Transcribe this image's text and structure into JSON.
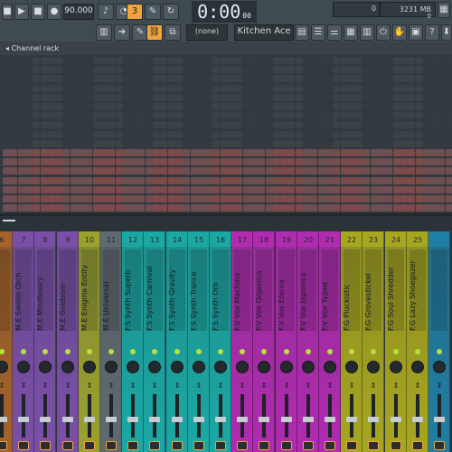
{
  "toolbar": {
    "tempo": "90.000",
    "time": "0:00",
    "time_suffix": "00",
    "meter_value": "0",
    "memory_value": "3231 MB",
    "memory_zero": "0",
    "pattern_select": "(none)",
    "preset": "Kitchen Ace"
  },
  "channel_rack": {
    "title": "Channel rack"
  },
  "mixer": {
    "strips": [
      {
        "num": "6",
        "name": "",
        "color": "#a5622b"
      },
      {
        "num": "7",
        "name": "M.E Swolln Orch",
        "color": "#7a4fa8"
      },
      {
        "num": "8",
        "name": "M.E Mindlessry",
        "color": "#7a4fa8"
      },
      {
        "num": "9",
        "name": "M.E Goldsom",
        "color": "#7a4fa8"
      },
      {
        "num": "10",
        "name": "M.E Enigma Entity",
        "color": "#9aa12f"
      },
      {
        "num": "11",
        "name": "M.E Universal",
        "color": "#5f6a70"
      },
      {
        "num": "12",
        "name": "F.S Synth Superb",
        "color": "#1aa8a5"
      },
      {
        "num": "13",
        "name": "F.S Synth Carnival",
        "color": "#1aa8a5"
      },
      {
        "num": "14",
        "name": "F.S Synth Gravity",
        "color": "#1aa8a5"
      },
      {
        "num": "15",
        "name": "F.S Synth Trance",
        "color": "#1aa8a5"
      },
      {
        "num": "16",
        "name": "F.S Synth Orb",
        "color": "#1aa8a5"
      },
      {
        "num": "17",
        "name": "F.V Vox Machina",
        "color": "#b02bb0"
      },
      {
        "num": "18",
        "name": "F.V Vox Organica",
        "color": "#b02bb0"
      },
      {
        "num": "19",
        "name": "F.V Vox Eterna",
        "color": "#b02bb0"
      },
      {
        "num": "20",
        "name": "F.V Vox Japonica",
        "color": "#b02bb0"
      },
      {
        "num": "21",
        "name": "F.V Vox Typed",
        "color": "#b02bb0"
      },
      {
        "num": "22",
        "name": "F.G Pluckistic",
        "color": "#a7a61f"
      },
      {
        "num": "23",
        "name": "F.G Grovestickel",
        "color": "#a7a61f"
      },
      {
        "num": "24",
        "name": "F.G Soul Shredder",
        "color": "#a7a61f"
      },
      {
        "num": "25",
        "name": "F.G Lazy Shoegazer",
        "color": "#a7a61f"
      },
      {
        "num": "",
        "name": "",
        "color": "#1f7ea3"
      }
    ]
  },
  "colors": {
    "accent": "#f2a33a",
    "toolbar": "#404a51",
    "rack": "#34393f"
  }
}
